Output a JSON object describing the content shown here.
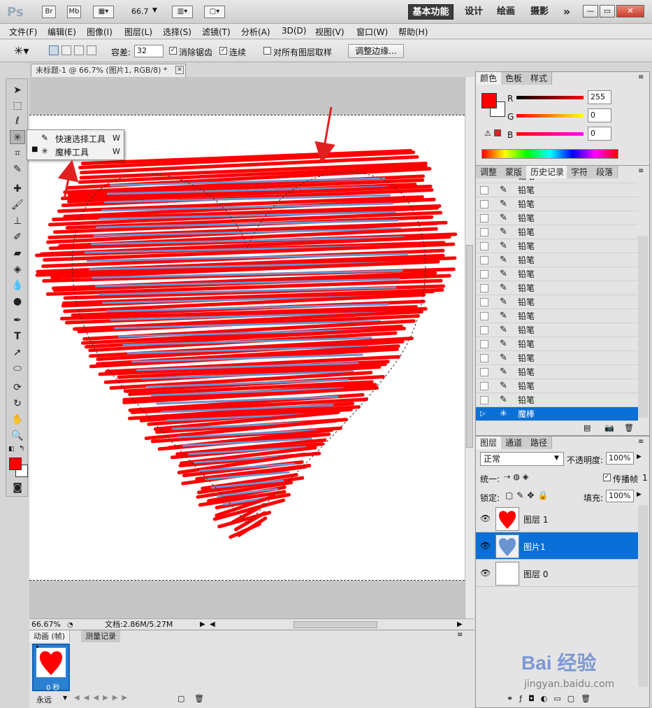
{
  "app": {
    "logo": "Ps"
  },
  "titlebar": {
    "icons": [
      "Br",
      "Mb"
    ],
    "zoom": "66.7",
    "workspaces": [
      "基本功能",
      "设计",
      "绘画",
      "摄影"
    ],
    "more": "»"
  },
  "menu": [
    "文件(F)",
    "编辑(E)",
    "图像(I)",
    "图层(L)",
    "选择(S)",
    "滤镜(T)",
    "分析(A)",
    "3D(D)",
    "视图(V)",
    "窗口(W)",
    "帮助(H)"
  ],
  "options": {
    "tolerance_label": "容差:",
    "tolerance_value": "32",
    "anti_alias": "消除锯齿",
    "contiguous": "连续",
    "sample_all": "对所有图层取样",
    "refine_edge": "调整边缘..."
  },
  "document": {
    "tab_title": "未标题-1 @ 66.7% (图片1, RGB/8) *",
    "zoom_status": "66.67%",
    "doc_size": "文档:2.86M/5.27M"
  },
  "flyout": {
    "items": [
      {
        "label": "快速选择工具",
        "shortcut": "W"
      },
      {
        "label": "魔棒工具",
        "shortcut": "W"
      }
    ]
  },
  "color_panel": {
    "tabs": [
      "颜色",
      "色板",
      "样式"
    ],
    "channels": [
      {
        "name": "R",
        "value": "255"
      },
      {
        "name": "G",
        "value": "0"
      },
      {
        "name": "B",
        "value": "0"
      }
    ],
    "foreground": "#ff0000"
  },
  "history_panel": {
    "tabs": [
      "调整",
      "蒙版",
      "历史记录",
      "字符",
      "段落"
    ],
    "items": [
      "铅笔",
      "铅笔",
      "铅笔",
      "铅笔",
      "铅笔",
      "铅笔",
      "铅笔",
      "铅笔",
      "铅笔",
      "铅笔",
      "铅笔",
      "铅笔",
      "铅笔",
      "铅笔",
      "铅笔",
      "铅笔",
      "魔棒"
    ],
    "top_partial": "铅笔"
  },
  "layers_panel": {
    "tabs": [
      "图层",
      "通道",
      "路径"
    ],
    "blend_mode": "正常",
    "opacity_label": "不透明度:",
    "opacity_value": "100%",
    "unify_label": "统一:",
    "propagate_label": "传播帧",
    "propagate_value": "1",
    "lock_label": "锁定:",
    "fill_label": "填充:",
    "fill_value": "100%",
    "layers": [
      {
        "name": "图层 1"
      },
      {
        "name": "图片1"
      },
      {
        "name": "图层 0"
      }
    ]
  },
  "animation_panel": {
    "tabs": [
      "动画 (帧)",
      "测量记录"
    ],
    "frame_number": "1",
    "frame_time": "0 秒",
    "loop": "永远"
  },
  "watermark": {
    "brand": "Bai 经验",
    "url": "jingyan.baidu.com"
  },
  "colors": {
    "selected_row": "#0a6fd6",
    "heart_red": "#ff0000",
    "heart_blue": "#6a94d0"
  }
}
